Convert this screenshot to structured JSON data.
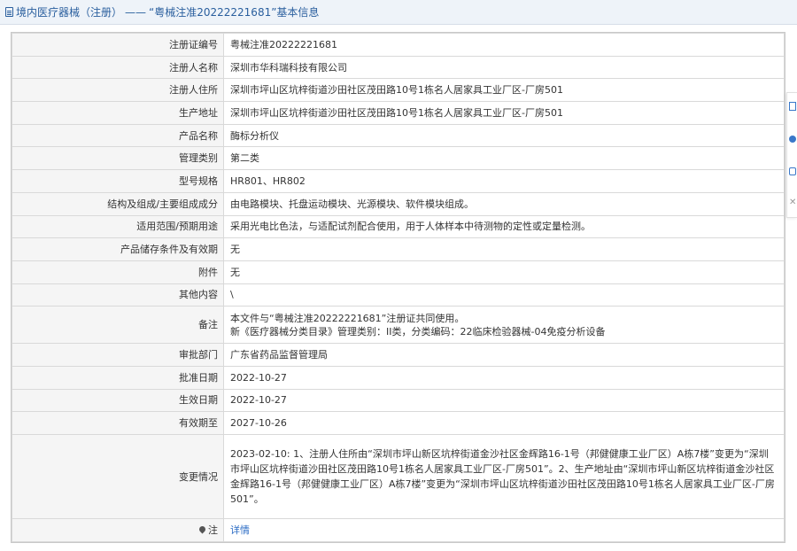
{
  "header": {
    "breadcrumb": "境内医疗器械（注册）",
    "separator": "——",
    "title": "“粤械注准20222221681”基本信息"
  },
  "rows": [
    {
      "label": "注册证编号",
      "value": "粤械注准20222221681"
    },
    {
      "label": "注册人名称",
      "value": "深圳市华科瑞科技有限公司"
    },
    {
      "label": "注册人住所",
      "value": "深圳市坪山区坑梓街道沙田社区茂田路10号1栋名人居家具工业厂区-厂房501"
    },
    {
      "label": "生产地址",
      "value": "深圳市坪山区坑梓街道沙田社区茂田路10号1栋名人居家具工业厂区-厂房501"
    },
    {
      "label": "产品名称",
      "value": "酶标分析仪"
    },
    {
      "label": "管理类别",
      "value": "第二类"
    },
    {
      "label": "型号规格",
      "value": "HR801、HR802"
    },
    {
      "label": "结构及组成/主要组成成分",
      "value": "由电路模块、托盘运动模块、光源模块、软件模块组成。"
    },
    {
      "label": "适用范围/预期用途",
      "value": "采用光电比色法，与适配试剂配合使用，用于人体样本中待测物的定性或定量检测。"
    },
    {
      "label": "产品储存条件及有效期",
      "value": "无"
    },
    {
      "label": "附件",
      "value": "无"
    },
    {
      "label": "其他内容",
      "value": "\\"
    }
  ],
  "remark": {
    "label": "备注",
    "line1": "本文件与“粤械注准20222221681”注册证共同使用。",
    "line2": "新《医疗器械分类目录》管理类别：II类，分类编码：22临床检验器械-04免疫分析设备"
  },
  "rows2": [
    {
      "label": "审批部门",
      "value": "广东省药品监督管理局"
    },
    {
      "label": "批准日期",
      "value": "2022-10-27"
    },
    {
      "label": "生效日期",
      "value": "2022-10-27"
    },
    {
      "label": "有效期至",
      "value": "2027-10-26"
    }
  ],
  "change": {
    "label": "变更情况",
    "text": "2023-02-10: 1、注册人住所由“深圳市坪山新区坑梓街道金沙社区金辉路16-1号（邦健健康工业厂区）A栋7楼”变更为“深圳市坪山区坑梓街道沙田社区茂田路10号1栋名人居家具工业厂区-厂房501”。2、生产地址由“深圳市坪山新区坑梓街道金沙社区金辉路16-1号（邦健健康工业厂区）A栋7楼”变更为“深圳市坪山区坑梓街道沙田社区茂田路10号1栋名人居家具工业厂区-厂房501”。"
  },
  "note": {
    "label": "注",
    "link_text": "详情"
  }
}
